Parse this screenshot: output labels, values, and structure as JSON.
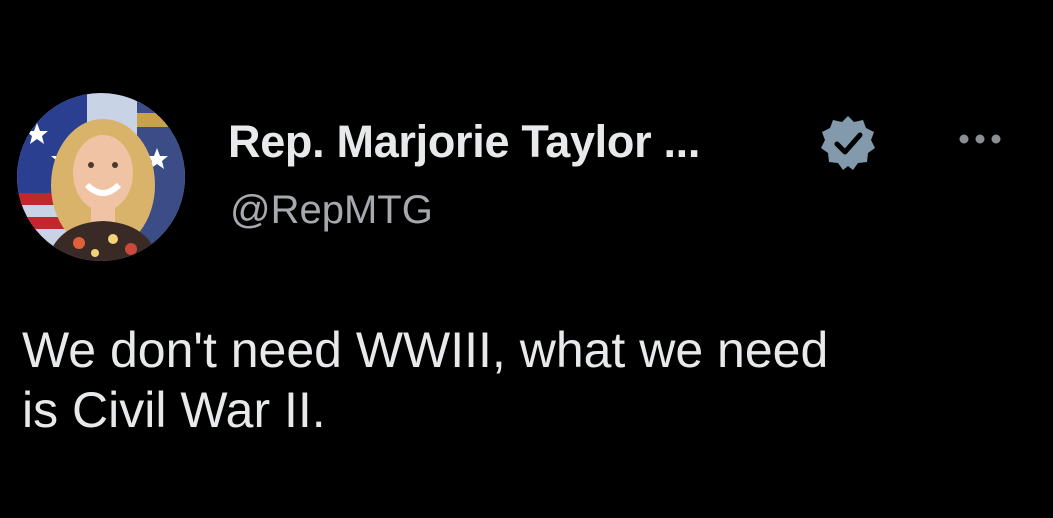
{
  "author": {
    "display_name": "Rep. Marjorie Taylor ...",
    "handle": "@RepMTG",
    "avatar_icon": "profile-photo",
    "verified_icon": "verified-badge-icon",
    "verified_color": "#829aab"
  },
  "menu": {
    "more_icon": "more-options-icon"
  },
  "tweet": {
    "lines": [
      "We don't need WWIII, what we need",
      "is Civil War II."
    ]
  },
  "colors": {
    "background": "#000000",
    "primary_text": "#e7e9ea",
    "secondary_text": "#a6a9ad"
  }
}
